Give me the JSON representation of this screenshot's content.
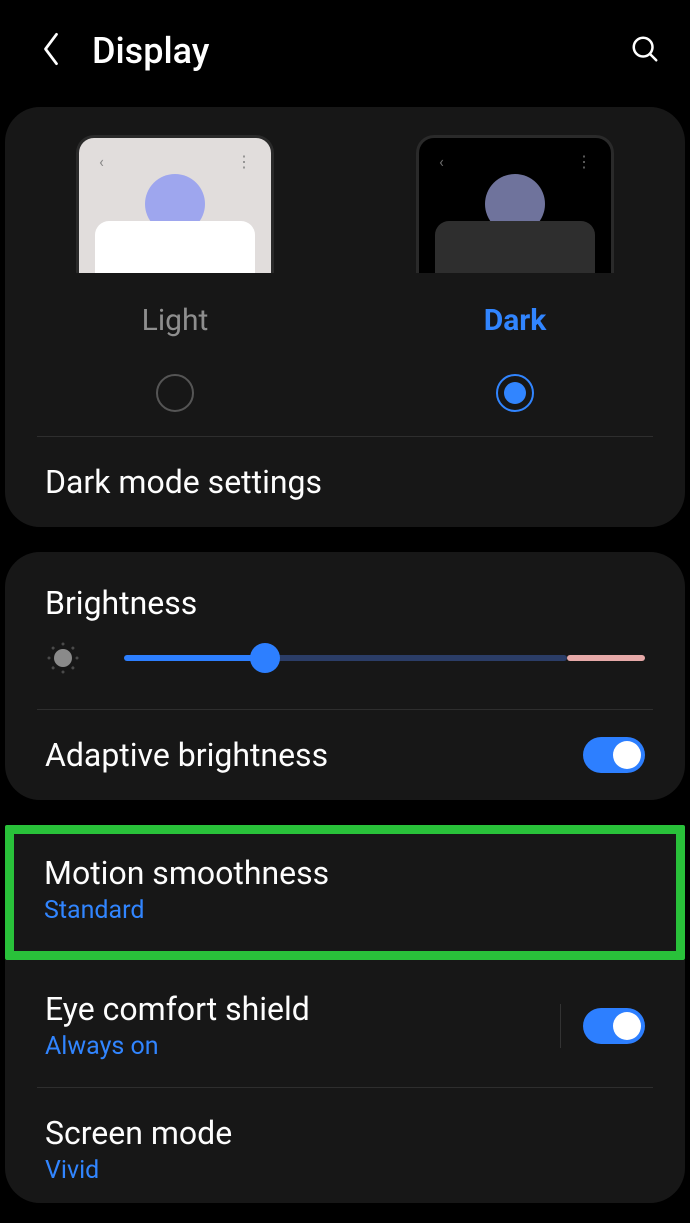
{
  "header": {
    "title": "Display"
  },
  "theme": {
    "light_label": "Light",
    "dark_label": "Dark",
    "selected": "dark"
  },
  "dark_mode_settings": {
    "title": "Dark mode settings"
  },
  "brightness": {
    "title": "Brightness",
    "value_percent": 27
  },
  "adaptive_brightness": {
    "title": "Adaptive brightness",
    "enabled": true
  },
  "motion_smoothness": {
    "title": "Motion smoothness",
    "value": "Standard"
  },
  "eye_comfort": {
    "title": "Eye comfort shield",
    "value": "Always on",
    "enabled": true
  },
  "screen_mode": {
    "title": "Screen mode",
    "value": "Vivid"
  }
}
